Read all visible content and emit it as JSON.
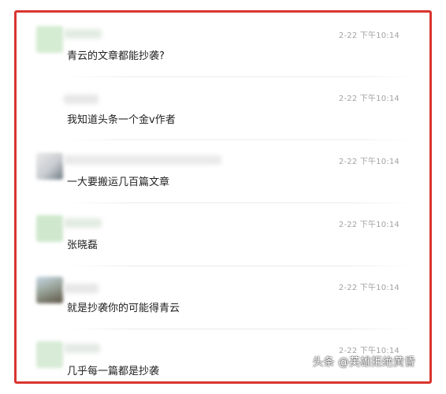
{
  "colors": {
    "frame_border": "#d9352f",
    "timestamp": "#a3a3a3",
    "text": "#222222",
    "avatar_green": "#cfe8cd",
    "avatar_gray": "#d8d8d8"
  },
  "comments": [
    {
      "time": "2-22 下午10:14",
      "text": "青云的文章都能抄袭?",
      "avatar": "blurred-avatar"
    },
    {
      "time": "2-22 下午10:14",
      "text": "我知道头条一个金v作者",
      "avatar": "blurred-avatar"
    },
    {
      "time": "2-22 下午10:14",
      "text": "一大要搬运几百篇文章",
      "avatar": "blurred-avatar"
    },
    {
      "time": "2-22 下午10:14",
      "text": "张晓磊",
      "avatar": "blurred-avatar"
    },
    {
      "time": "2-22 下午10:14",
      "text": "就是抄袭你的可能得青云",
      "avatar": "blurred-avatar"
    },
    {
      "time": "2-22 下午10:14",
      "text": "几乎每一篇都是抄袭",
      "avatar": "blurred-avatar"
    }
  ],
  "watermark": "头条 @英雄拒绝黄昏"
}
